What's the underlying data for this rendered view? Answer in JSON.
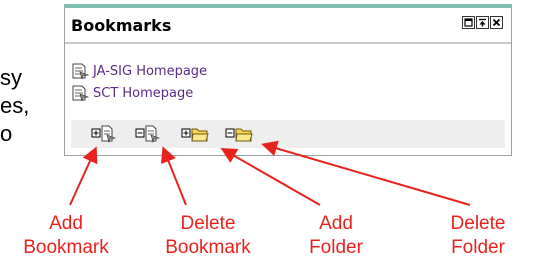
{
  "background_text": [
    "sy",
    "es,",
    "o"
  ],
  "channel": {
    "title": "Bookmarks",
    "controls": [
      "restore-icon",
      "minimize-icon",
      "close-icon"
    ],
    "bookmarks": [
      {
        "label": "JA-SIG Homepage",
        "icon": "bookmark-page-icon"
      },
      {
        "label": "SCT Homepage",
        "icon": "bookmark-page-icon"
      }
    ],
    "toolbar": [
      {
        "name": "add-bookmark-button",
        "icon": "add-bookmark-icon"
      },
      {
        "name": "delete-bookmark-button",
        "icon": "delete-bookmark-icon"
      },
      {
        "name": "add-folder-button",
        "icon": "add-folder-icon"
      },
      {
        "name": "delete-folder-button",
        "icon": "delete-folder-icon"
      }
    ]
  },
  "annotations": {
    "add_bookmark": [
      "Add",
      "Bookmark"
    ],
    "delete_bookmark": [
      "Delete",
      "Bookmark"
    ],
    "add_folder": [
      "Add",
      "Folder"
    ],
    "delete_folder": [
      "Delete",
      "Folder"
    ]
  },
  "colors": {
    "accent_border": "#7fbfb1",
    "link": "#5b2b87",
    "annotation": "#e8231e",
    "toolbar_bg": "#eeeeee"
  }
}
